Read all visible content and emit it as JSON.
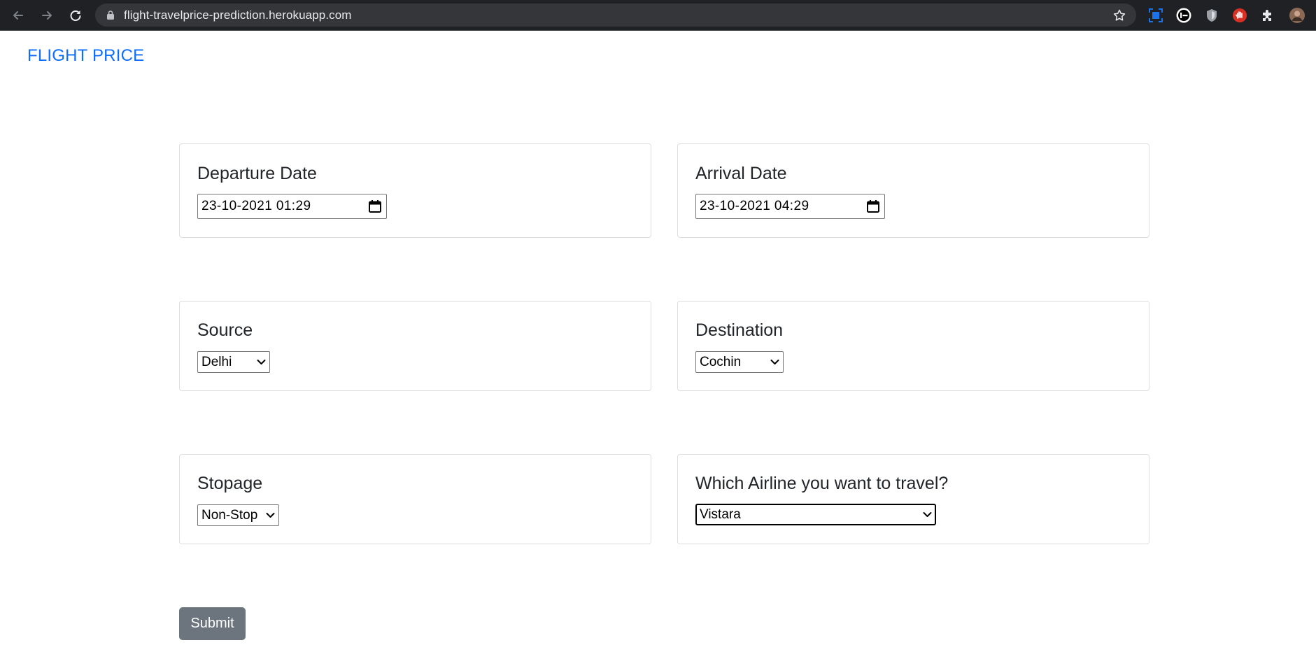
{
  "browser": {
    "url": "flight-travelprice-prediction.herokuapp.com"
  },
  "header": {
    "brand": "FLIGHT PRICE"
  },
  "form": {
    "departure": {
      "label": "Departure Date",
      "value": "23-10-2021 01:29"
    },
    "arrival": {
      "label": "Arrival Date",
      "value": "23-10-2021 04:29"
    },
    "source": {
      "label": "Source",
      "selected": "Delhi"
    },
    "destination": {
      "label": "Destination",
      "selected": "Cochin"
    },
    "stopage": {
      "label": "Stopage",
      "selected": "Non-Stop"
    },
    "airline": {
      "label": "Which Airline you want to travel?",
      "selected": "Vistara"
    },
    "submit_label": "Submit"
  },
  "colors": {
    "brand": "#0d6efd",
    "submit_bg": "#6c757d",
    "chrome_bg": "#202124"
  },
  "icons": {
    "back": "arrow-left-icon",
    "forward": "arrow-right-icon",
    "reload": "reload-icon",
    "lock": "lock-icon",
    "bookmark": "star-icon",
    "calendar": "calendar-icon",
    "dropdown": "chevron-down-icon",
    "extensions": "puzzle-icon"
  }
}
